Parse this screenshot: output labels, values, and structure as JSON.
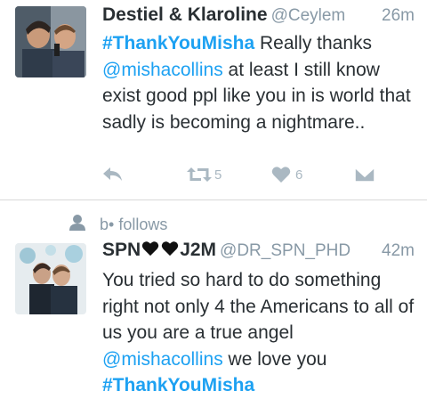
{
  "tweets": [
    {
      "display_name": "Destiel & Klaroline",
      "handle": "@Ceylem",
      "time": "26m",
      "body_parts": [
        {
          "t": "#ThankYouMisha",
          "hl": true,
          "bold": true
        },
        {
          "t": " Really thanks ",
          "hl": false,
          "bold": false
        },
        {
          "t": "@mishacollins",
          "hl": true,
          "bold": false
        },
        {
          "t": " at least I still know exist good ppl like you in is world that sadly is becoming a nightmare..",
          "hl": false,
          "bold": false
        }
      ],
      "actions": {
        "reply_icon": "reply-icon",
        "retweet_icon": "retweet-icon",
        "retweet_count": "5",
        "like_icon": "heart-icon",
        "like_count": "6",
        "dm_icon": "envelope-icon"
      }
    },
    {
      "context_icon": "person-icon",
      "context_text": "b• follows",
      "display_name_prefix": "SPN",
      "display_name_suffix": "J2M",
      "name_heart_icons": [
        "black-heart-icon",
        "black-heart-icon"
      ],
      "handle": "@DR_SPN_PHD",
      "time": "42m",
      "body_parts": [
        {
          "t": "You tried so hard to do something right not only 4 the Americans to all of us you are a true angel ",
          "hl": false,
          "bold": false
        },
        {
          "t": "@mishacollins",
          "hl": true,
          "bold": false
        },
        {
          "t": " we love you ",
          "hl": false,
          "bold": false
        },
        {
          "t": "#ThankYouMisha",
          "hl": true,
          "bold": true
        }
      ]
    }
  ],
  "colors": {
    "link": "#1da1f2",
    "text": "#292f33",
    "muted": "#8899a6",
    "action": "#aab8c2"
  }
}
